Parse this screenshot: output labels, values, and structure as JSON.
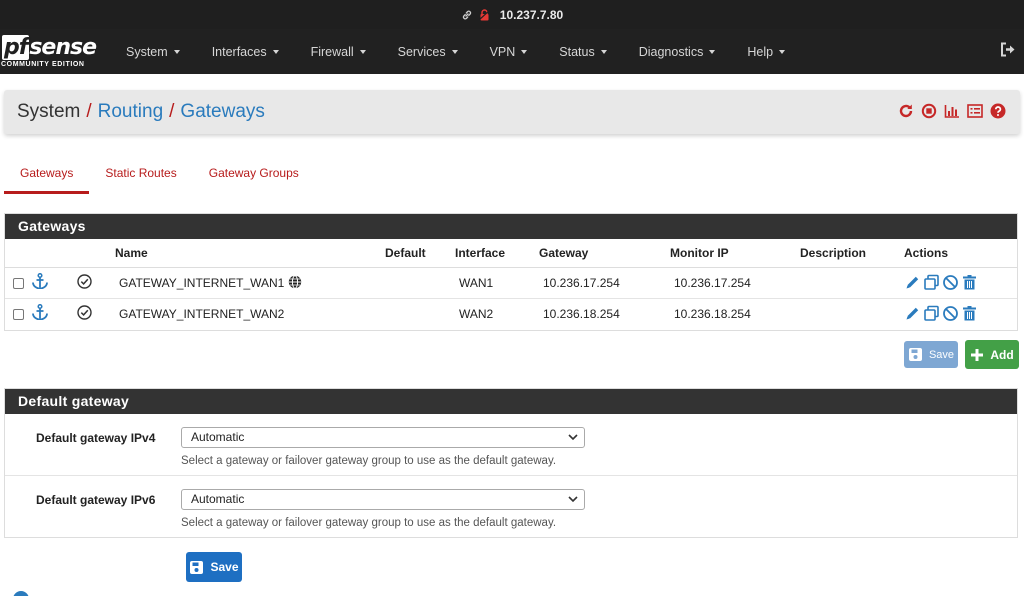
{
  "browser": {
    "url": "10.237.7.80"
  },
  "logo": {
    "brand_pf": "pf",
    "brand_rest": "sense",
    "edition": "COMMUNITY EDITION"
  },
  "nav": {
    "items": [
      {
        "label": "System"
      },
      {
        "label": "Interfaces"
      },
      {
        "label": "Firewall"
      },
      {
        "label": "Services"
      },
      {
        "label": "VPN"
      },
      {
        "label": "Status"
      },
      {
        "label": "Diagnostics"
      },
      {
        "label": "Help"
      }
    ]
  },
  "breadcrumb": {
    "root": "System",
    "sep": "/",
    "level1": "Routing",
    "level2": "Gateways"
  },
  "tabs": [
    {
      "label": "Gateways",
      "active": true
    },
    {
      "label": "Static Routes",
      "active": false
    },
    {
      "label": "Gateway Groups",
      "active": false
    }
  ],
  "gateways_panel": {
    "title": "Gateways",
    "columns": [
      "Name",
      "Default",
      "Interface",
      "Gateway",
      "Monitor IP",
      "Description",
      "Actions"
    ],
    "rows": [
      {
        "name": "GATEWAY_INTERNET_WAN1",
        "default": "",
        "interface": "WAN1",
        "gateway": "10.236.17.254",
        "monitor_ip": "10.236.17.254",
        "description": ""
      },
      {
        "name": "GATEWAY_INTERNET_WAN2",
        "default": "",
        "interface": "WAN2",
        "gateway": "10.236.18.254",
        "monitor_ip": "10.236.18.254",
        "description": ""
      }
    ],
    "save_label": "Save",
    "add_label": "Add"
  },
  "default_gateway_panel": {
    "title": "Default gateway",
    "ipv4": {
      "label": "Default gateway IPv4",
      "value": "Automatic",
      "help": "Select a gateway or failover gateway group to use as the default gateway."
    },
    "ipv6": {
      "label": "Default gateway IPv6",
      "value": "Automatic",
      "help": "Select a gateway or failover gateway group to use as the default gateway."
    }
  },
  "save_label": "Save",
  "colors": {
    "accent": "#b71c1c",
    "link": "#2a7bbd",
    "navbar": "#212121",
    "panel_head": "#333333",
    "add_button": "#43a047",
    "save_button": "#1e6fc2"
  }
}
